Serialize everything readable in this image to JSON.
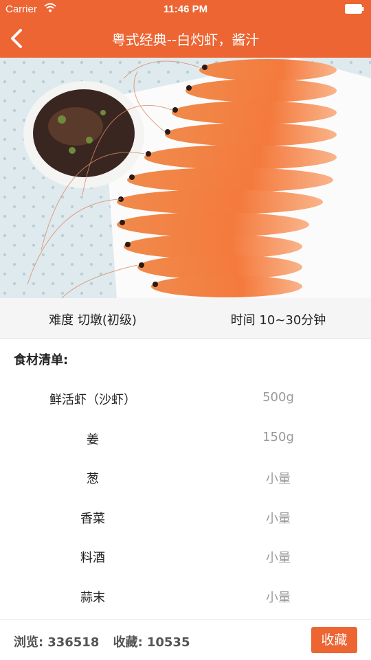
{
  "status_bar": {
    "carrier": "Carrier",
    "time": "11:46 PM"
  },
  "nav": {
    "title": "粤式经典--白灼虾，酱汁",
    "back_icon": "chevron-left-icon"
  },
  "hero": {
    "image_name": "boiled-shrimp-photo"
  },
  "meta": {
    "difficulty": "难度  切墩(初级)",
    "time": "时间  10~30分钟"
  },
  "ingredients": {
    "title": "食材清单:",
    "items": [
      {
        "name": "鲜活虾（沙虾）",
        "amount": "500g"
      },
      {
        "name": "姜",
        "amount": "150g"
      },
      {
        "name": "葱",
        "amount": "小量"
      },
      {
        "name": "香菜",
        "amount": "小量"
      },
      {
        "name": "料酒",
        "amount": "小量"
      },
      {
        "name": "蒜末",
        "amount": "小量"
      }
    ]
  },
  "footer": {
    "views_label": "浏览:",
    "views": "336518",
    "favorites_label": "收藏:",
    "favorites": "10535",
    "favorite_button": "收藏"
  },
  "colors": {
    "accent": "#ec6533",
    "muted_text": "#9a9a9a"
  }
}
